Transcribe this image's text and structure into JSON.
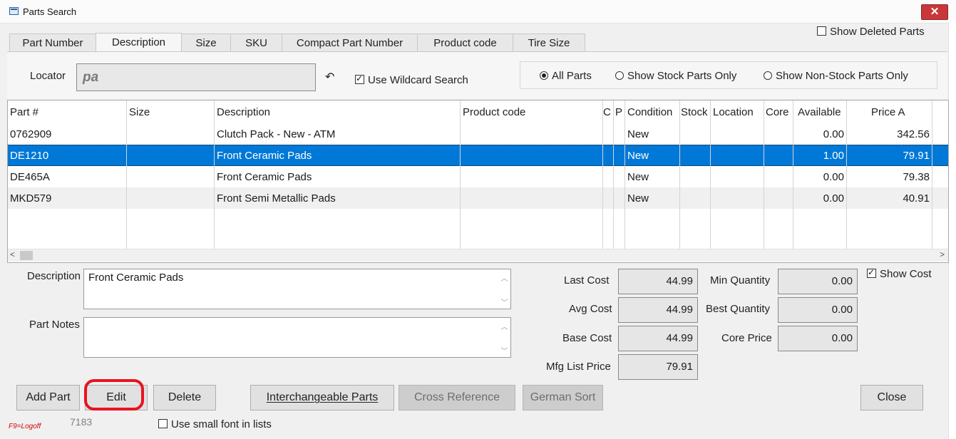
{
  "window": {
    "title": "Parts Search",
    "close_glyph": "✕"
  },
  "show_deleted_label": "Show Deleted Parts",
  "tabs": [
    {
      "label": "Part Number"
    },
    {
      "label": "Description",
      "active": true
    },
    {
      "label": "Size"
    },
    {
      "label": "SKU"
    },
    {
      "label": "Compact Part Number"
    },
    {
      "label": "Product code"
    },
    {
      "label": "Tire Size"
    }
  ],
  "locator": {
    "label": "Locator",
    "value": "pa",
    "undo_glyph": "↶"
  },
  "wildcard": {
    "label": "Use Wildcard Search",
    "checked": true
  },
  "filter_options": [
    {
      "label": "All Parts",
      "selected": true
    },
    {
      "label": "Show Stock Parts Only",
      "selected": false
    },
    {
      "label": "Show Non-Stock Parts Only",
      "selected": false
    }
  ],
  "grid": {
    "columns": [
      "Part #",
      "Size",
      "Description",
      "Product code",
      "C",
      "P",
      "Condition",
      "Stock",
      "Location",
      "Core",
      "Available",
      "Price A"
    ],
    "rows": [
      {
        "part": "0762909",
        "size": "",
        "desc": "Clutch Pack - New - ATM",
        "product": "",
        "c": "",
        "p": "",
        "condition": "New",
        "stock": "",
        "location": "",
        "core": "",
        "available": "0.00",
        "price": "342.56"
      },
      {
        "part": "DE1210",
        "size": "",
        "desc": "Front Ceramic Pads",
        "product": "",
        "c": "",
        "p": "",
        "condition": "New",
        "stock": "",
        "location": "",
        "core": "",
        "available": "1.00",
        "price": "79.91",
        "selected": true
      },
      {
        "part": "DE465A",
        "size": "",
        "desc": "Front Ceramic Pads",
        "product": "",
        "c": "",
        "p": "",
        "condition": "New",
        "stock": "",
        "location": "",
        "core": "",
        "available": "0.00",
        "price": "79.38"
      },
      {
        "part": "MKD579",
        "size": "",
        "desc": "Front Semi Metallic Pads",
        "product": "",
        "c": "",
        "p": "",
        "condition": "New",
        "stock": "",
        "location": "",
        "core": "",
        "available": "0.00",
        "price": "40.91"
      }
    ],
    "scroll_left_glyph": "<",
    "scroll_right_glyph": ">"
  },
  "details": {
    "description_label": "Description",
    "description_value": "Front Ceramic Pads",
    "notes_label": "Part Notes",
    "notes_value": "",
    "last_cost_label": "Last Cost",
    "last_cost": "44.99",
    "avg_cost_label": "Avg Cost",
    "avg_cost": "44.99",
    "base_cost_label": "Base Cost",
    "base_cost": "44.99",
    "mfg_list_label": "Mfg List Price",
    "mfg_list": "79.91",
    "min_qty_label": "Min Quantity",
    "min_qty": "0.00",
    "best_qty_label": "Best Quantity",
    "best_qty": "0.00",
    "core_price_label": "Core Price",
    "core_price": "0.00",
    "show_cost_label": "Show Cost",
    "show_cost_checked": true
  },
  "buttons": {
    "add_part": "Add Part",
    "edit": "Edit",
    "delete": "Delete",
    "interchangeable": "Interchangeable Parts",
    "cross_reference": "Cross Reference",
    "german_sort": "German Sort",
    "close": "Close"
  },
  "footer": {
    "logoff_hint": "F9=Logoff",
    "record_number": "7183",
    "small_font_label": "Use small font in lists",
    "small_font_checked": false
  },
  "colors": {
    "selection": "#0078d7",
    "close_button": "#c8383b",
    "highlight_ring": "#e8141f",
    "logoff_hint": "#d40000"
  }
}
